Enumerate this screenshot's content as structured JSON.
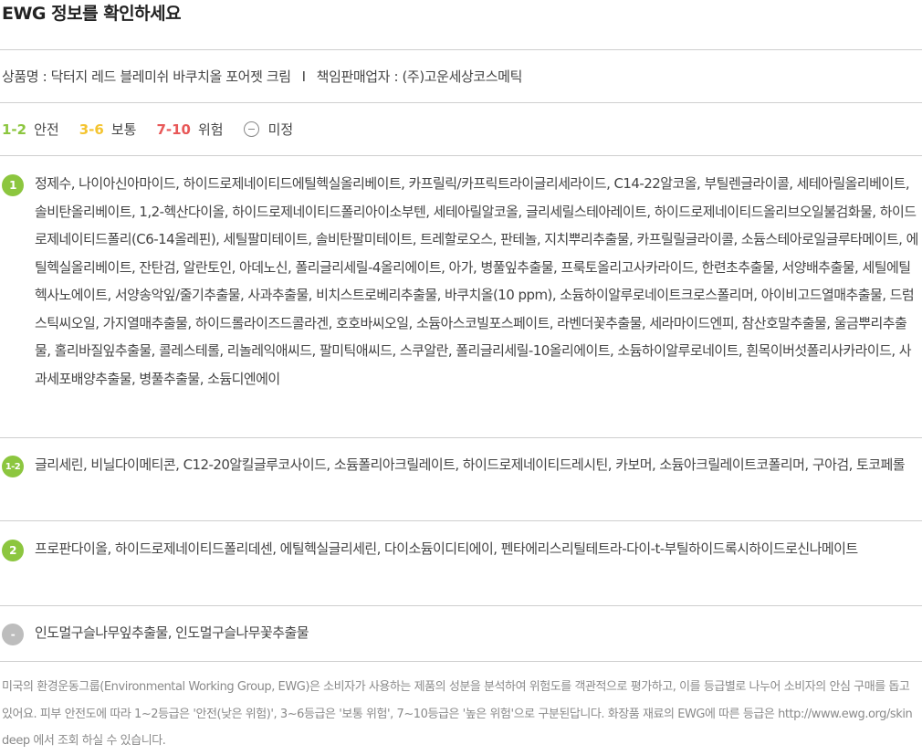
{
  "header": {
    "title": "EWG 정보를 확인하세요"
  },
  "product": {
    "name_label": "상품명 : 닥터지 레드 블레미쉬 바쿠치올 포어젯 크림",
    "separator": "I",
    "seller_label": "책임판매업자 : (주)고운세상코스메틱"
  },
  "legend": {
    "items": [
      {
        "range": "1-2",
        "label": "안전",
        "color": "#8cc63f"
      },
      {
        "range": "3-6",
        "label": "보통",
        "color": "#f4c430"
      },
      {
        "range": "7-10",
        "label": "위험",
        "color": "#e85858"
      }
    ],
    "unknown_label": "미정"
  },
  "groups": [
    {
      "badge": "1",
      "color": "#8cc63f",
      "ingredients": "정제수, 나이아신아마이드, 하이드로제네이티드에틸헥실올리베이트, 카프릴릭/카프릭트라이글리세라이드, C14-22알코올, 부틸렌글라이콜, 세테아릴올리베이트, 솔비탄올리베이트, 1,2-헥산다이올, 하이드로제네이티드폴리아이소부텐, 세테아릴알코올, 글리세릴스테아레이트, 하이드로제네이티드올리브오일불검화물, 하이드로제네이티드폴리(C6-14올레핀), 세틸팔미테이트, 솔비탄팔미테이트, 트레할로오스, 판테놀, 지치뿌리추출물, 카프릴릴글라이콜, 소듐스테아로일글루타메이트, 에틸헥실올리베이트, 잔탄검, 알란토인, 아데노신, 폴리글리세릴-4올리에이트, 아가, 병풀잎추출물, 프룩토올리고사카라이드, 한련초추출물, 서양배추출물, 세틸에틸헥사노에이트, 서양송악잎/줄기추출물, 사과추출물, 비치스트로베리추출물, 바쿠치올(10 ppm), 소듐하이알루로네이트크로스폴리머, 아이비고드열매추출물, 드럼스틱씨오일, 가지열매추출물, 하이드롤라이즈드콜라겐, 호호바씨오일, 소듐아스코빌포스페이트, 라벤더꽃추출물, 세라마이드엔피, 참산호말추출물, 울금뿌리추출물, 홀리바질잎추출물, 콜레스테롤, 리놀레익애씨드, 팔미틱애씨드, 스쿠알란, 폴리글리세릴-10올리에이트, 소듐하이알루로네이트, 흰목이버섯폴리사카라이드, 사과세포배양추출물, 병풀추출물, 소듐디엔에이"
    },
    {
      "badge": "1-2",
      "color": "#8cc63f",
      "ingredients": "글리세린, 비닐다이메티콘, C12-20알킬글루코사이드, 소듐폴리아크릴레이트, 하이드로제네이티드레시틴, 카보머, 소듐아크릴레이트코폴리머, 구아검, 토코페롤"
    },
    {
      "badge": "2",
      "color": "#8cc63f",
      "ingredients": "프로판다이올, 하이드로제네이티드폴리데센, 에틸헥실글리세린, 다이소듐이디티에이, 펜타에리스리틸테트라-다이-t-부틸하이드록시하이드로신나메이트"
    },
    {
      "badge": "-",
      "color": "#bdbdbd",
      "ingredients": "인도멀구슬나무잎추출물, 인도멀구슬나무꽃추출물"
    }
  ],
  "footnote": "미국의 환경운동그룹(Environmental Working Group, EWG)은 소비자가 사용하는 제품의 성분을 분석하여 위험도를 객관적으로 평가하고, 이를 등급별로 나누어 소비자의 안심 구매를 돕고 있어요. 피부 안전도에 따라 1~2등급은 '안전(낮은 위험)', 3~6등급은 '보통 위험', 7~10등급은 '높은 위험'으로 구분된답니다. 화장품 재료의 EWG에 따른 등급은 http://www.ewg.org/skindeep 에서 조회 하실 수 있습니다."
}
